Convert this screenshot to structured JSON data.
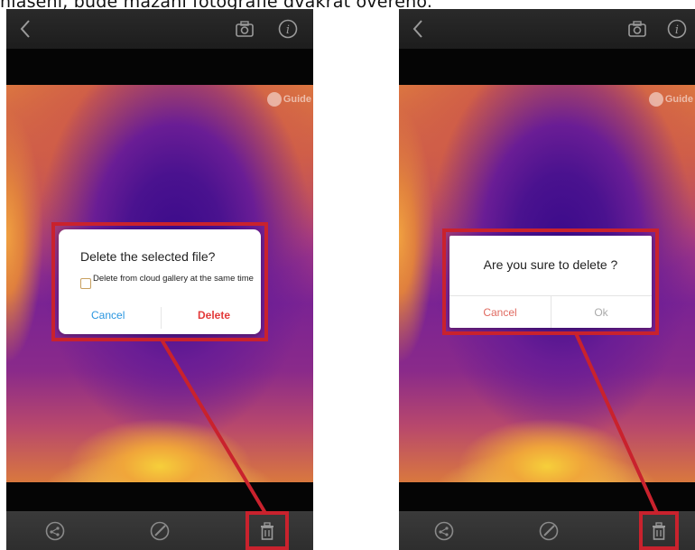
{
  "caption": "hlasení, bude mazání fotografie dvakrát ověřeno.",
  "left_phone": {
    "watermark": "Guide",
    "dialog": {
      "title": "Delete the selected file?",
      "checkbox_label": "Delete from cloud gallery at the same time",
      "cancel": "Cancel",
      "delete": "Delete"
    }
  },
  "right_phone": {
    "watermark": "Guide",
    "dialog": {
      "title": "Are you sure to delete ?",
      "cancel": "Cancel",
      "ok": "Ok"
    }
  },
  "icons": {
    "top": [
      "back-icon",
      "camera-icon",
      "info-icon"
    ],
    "bottom": [
      "share-icon",
      "edit-icon",
      "trash-icon"
    ]
  },
  "colors": {
    "highlight": "#c9222d",
    "cancel_blue": "#2a96e0",
    "delete_red": "#e33a3a",
    "cancel_salmon": "#e06a60",
    "ok_gray": "#aaaaaa"
  }
}
